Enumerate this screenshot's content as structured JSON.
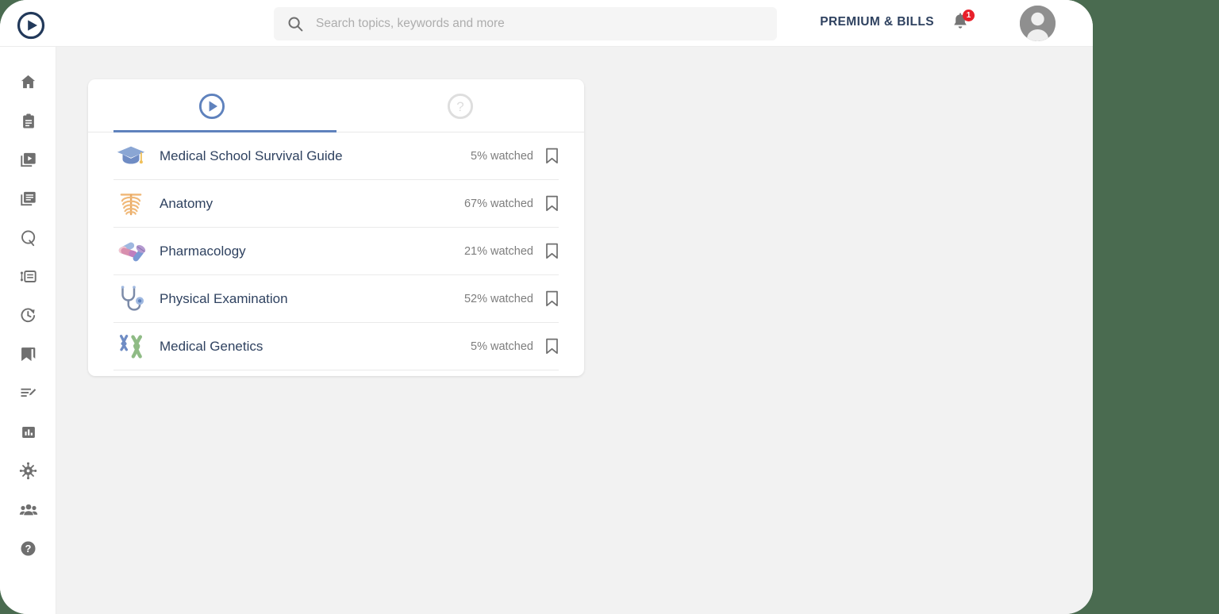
{
  "app": {
    "logo_icon": "play-circle-logo",
    "background_color": "#4a6b50",
    "content_background": "#f2f2f2"
  },
  "header": {
    "search": {
      "icon": "search-icon",
      "placeholder": "Search topics, keywords and more",
      "value": ""
    },
    "premium_label": "PREMIUM & BILLS",
    "notifications": {
      "icon": "bell-icon",
      "count": "1",
      "badge_color": "#e8202a"
    },
    "avatar_icon": "user-avatar"
  },
  "sidebar": {
    "items": [
      {
        "name": "home",
        "icon": "home-icon"
      },
      {
        "name": "study-plan",
        "icon": "clipboard-icon"
      },
      {
        "name": "videos",
        "icon": "video-library-icon"
      },
      {
        "name": "articles",
        "icon": "documents-icon"
      },
      {
        "name": "qbank",
        "icon": "q-letter-icon"
      },
      {
        "name": "flashcards",
        "icon": "list-card-icon"
      },
      {
        "name": "history",
        "icon": "clock-history-icon"
      },
      {
        "name": "bookmarks",
        "icon": "bookmark-stack-icon"
      },
      {
        "name": "notes",
        "icon": "notes-edit-icon"
      },
      {
        "name": "statistics",
        "icon": "bar-chart-icon"
      },
      {
        "name": "microbiology",
        "icon": "virus-icon"
      },
      {
        "name": "community",
        "icon": "people-icon"
      },
      {
        "name": "help",
        "icon": "help-circle-icon"
      }
    ]
  },
  "main": {
    "tabs": [
      {
        "name": "videos",
        "icon": "play-circle-icon",
        "active": true,
        "accent_color": "#5f82bd"
      },
      {
        "name": "questions",
        "icon": "question-circle-icon",
        "active": false,
        "accent_color": "#dedede"
      }
    ],
    "courses": [
      {
        "title": "Medical School Survival Guide",
        "icon": "graduation-cap-icon",
        "watched_label": "5% watched",
        "progress": 5,
        "bar_width_pct": 6,
        "bookmark_icon": "bookmark-outline-icon"
      },
      {
        "title": "Anatomy",
        "icon": "ribcage-icon",
        "watched_label": "67% watched",
        "progress": 67,
        "bar_width_pct": 68,
        "bookmark_icon": "bookmark-outline-icon"
      },
      {
        "title": "Pharmacology",
        "icon": "pills-icon",
        "watched_label": "21% watched",
        "progress": 21,
        "bar_width_pct": 16,
        "bookmark_icon": "bookmark-outline-icon"
      },
      {
        "title": "Physical Examination",
        "icon": "stethoscope-icon",
        "watched_label": "52% watched",
        "progress": 52,
        "bar_width_pct": 53,
        "bookmark_icon": "bookmark-outline-icon"
      },
      {
        "title": "Medical Genetics",
        "icon": "chromosome-icon",
        "watched_label": "5% watched",
        "progress": 5,
        "bar_width_pct": 6,
        "bookmark_icon": "bookmark-outline-icon"
      }
    ]
  }
}
